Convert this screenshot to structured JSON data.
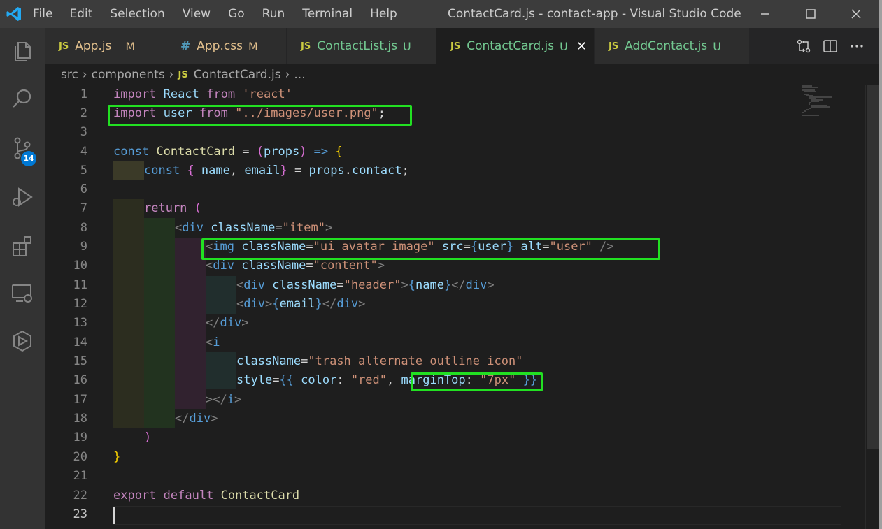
{
  "window": {
    "title": "ContactCard.js - contact-app - Visual Studio Code",
    "menu": [
      "File",
      "Edit",
      "Selection",
      "View",
      "Go",
      "Run",
      "Terminal",
      "Help"
    ]
  },
  "activity_bar": {
    "items": [
      "explorer-icon",
      "search-icon",
      "source-control-icon",
      "run-debug-icon",
      "extensions-icon",
      "remote-explorer-icon",
      "docker-icon"
    ],
    "source_control_badge": "14"
  },
  "tabs": [
    {
      "icon": "JS",
      "name": "App.js",
      "status": "M",
      "active": false,
      "color": "#e2c08d"
    },
    {
      "icon": "#",
      "name": "App.css",
      "status": "M",
      "active": false,
      "color": "#e2c08d"
    },
    {
      "icon": "JS",
      "name": "ContactList.js",
      "status": "U",
      "active": false,
      "color": "#73c991"
    },
    {
      "icon": "JS",
      "name": "ContactCard.js",
      "status": "U",
      "active": true,
      "color": "#73c991"
    },
    {
      "icon": "JS",
      "name": "AddContact.js",
      "status": "U",
      "active": false,
      "color": "#73c991"
    }
  ],
  "breadcrumb": {
    "parts": [
      "src",
      "components"
    ],
    "file_icon": "JS",
    "file": "ContactCard.js",
    "tail": "..."
  },
  "editor": {
    "line_numbers": [
      "1",
      "2",
      "3",
      "4",
      "5",
      "6",
      "7",
      "8",
      "9",
      "10",
      "11",
      "12",
      "13",
      "14",
      "15",
      "16",
      "17",
      "18",
      "19",
      "20",
      "21",
      "22",
      "23"
    ],
    "current_line": 23,
    "code": {
      "l1": {
        "import": "import",
        "react": "React",
        "from": "from",
        "str": "'react'"
      },
      "l2": {
        "import": "import",
        "user": "user",
        "from": "from",
        "str": "\"../images/user.png\"",
        "semi": ";"
      },
      "l4": {
        "const": "const",
        "name": "ContactCard",
        "eq": " = ",
        "lp": "(",
        "props": "props",
        "rp": ")",
        "arrow": " => ",
        "brace": "{"
      },
      "l5": {
        "const": "const",
        "lb": "{",
        "a": " name",
        "comma": ",",
        "b": " email",
        "rb": "}",
        "eq": " = ",
        "props": "props",
        "dot": ".",
        "contact": "contact",
        "semi": ";"
      },
      "l7": {
        "ret": "return",
        "lp": "("
      },
      "l8": {
        "open": "<",
        "tag": "div",
        "attr": "className",
        "eq": "=",
        "val": "\"item\"",
        "close": ">"
      },
      "l9": {
        "open": "<",
        "tag": "img",
        "attr1": "className",
        "eq1": "=",
        "val1": "\"ui avatar image\"",
        "attr2": "src",
        "eq2": "=",
        "lb": "{",
        "user": "user",
        "rb": "}",
        "attr3": "alt",
        "eq3": "=",
        "val3": "\"user\"",
        "close": " />"
      },
      "l10": {
        "open": "<",
        "tag": "div",
        "attr": "className",
        "eq": "=",
        "val": "\"content\"",
        "close": ">"
      },
      "l11": {
        "open": "<",
        "tag": "div",
        "attr": "className",
        "eq": "=",
        "val": "\"header\"",
        "gt": ">",
        "lb": "{",
        "name": "name",
        "rb": "}",
        "endopen": "</",
        "endtag": "div",
        "endclose": ">"
      },
      "l12": {
        "open": "<",
        "tag": "div",
        "gt": ">",
        "lb": "{",
        "email": "email",
        "rb": "}",
        "endopen": "</",
        "endtag": "div",
        "endclose": ">"
      },
      "l13": {
        "endopen": "</",
        "endtag": "div",
        "endclose": ">"
      },
      "l14": {
        "open": "<",
        "tag": "i"
      },
      "l15": {
        "attr": "className",
        "eq": "=",
        "val": "\"trash alternate outline icon\""
      },
      "l16": {
        "attr": "style",
        "eq": "=",
        "lb": "{{",
        "color": " color",
        "colon": ": ",
        "red": "\"red\"",
        "comma": ",",
        "mt": "marginTop",
        "colon2": ": ",
        "px": "\"7px\"",
        "rb": "}}"
      },
      "l17": {
        "close": "></",
        "tag": "i",
        "gt": ">"
      },
      "l18": {
        "endopen": "</",
        "endtag": "div",
        "endclose": ">"
      },
      "l19": {
        "rp": ")"
      },
      "l20": {
        "rb": "}"
      },
      "l22": {
        "export": "export",
        "default": "default",
        "name": "ContactCard"
      }
    }
  },
  "colors": {
    "highlight_box": "#22e022",
    "tab_modified": "#e2c08d",
    "tab_untracked": "#73c991",
    "badge": "#0078d4"
  }
}
